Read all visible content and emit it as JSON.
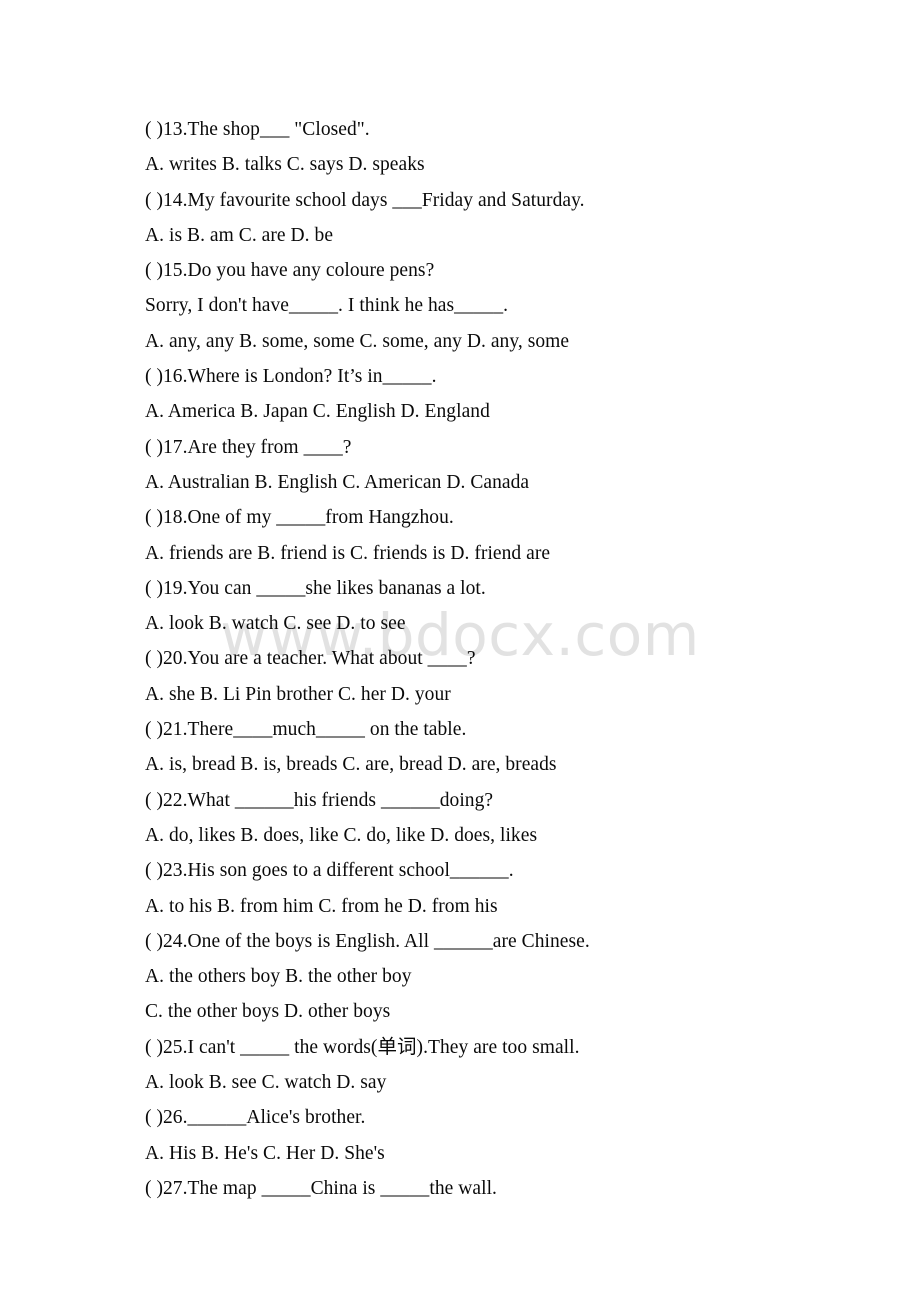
{
  "document": {
    "type": "english-multiple-choice-worksheet",
    "watermark": "www.bdocx.com",
    "text_color": "#0a0a0a",
    "watermark_color": "#e2e2e2",
    "background_color": "#ffffff",
    "lines": [
      {
        "id": "q13",
        "text": "( )13.The shop___ \"Closed\"."
      },
      {
        "id": "q13o",
        "text": "A. writes B. talks C. says D. speaks"
      },
      {
        "id": "q14",
        "text": "( )14.My favourite school days ___Friday and Saturday."
      },
      {
        "id": "q14o",
        "text": "A. is B. am C. are D. be"
      },
      {
        "id": "q15",
        "text": "( )15.Do you have any coloure pens?"
      },
      {
        "id": "q15b",
        "text": "Sorry, I don't have_____. I think he has_____."
      },
      {
        "id": "q15o",
        "text": "A. any, any B. some, some C. some, any D. any, some"
      },
      {
        "id": "q16",
        "text": "( )16.Where is London? It’s in_____."
      },
      {
        "id": "q16o",
        "text": "A. America B. Japan C. English D. England"
      },
      {
        "id": "q17",
        "text": "( )17.Are they from ____?"
      },
      {
        "id": "q17o",
        "text": "A. Australian B. English C. American D. Canada"
      },
      {
        "id": "q18",
        "text": "( )18.One of my _____from Hangzhou."
      },
      {
        "id": "q18o",
        "text": "A. friends are B. friend is C. friends is D. friend are"
      },
      {
        "id": "q19",
        "text": "( )19.You can _____she likes bananas a lot."
      },
      {
        "id": "q19o",
        "text": "A. look B. watch C. see D. to see"
      },
      {
        "id": "q20",
        "text": "( )20.You are a teacher. What about ____?"
      },
      {
        "id": "q20o",
        "text": "A. she B. Li Pin brother C. her D. your"
      },
      {
        "id": "q21",
        "text": "( )21.There____much_____ on the table."
      },
      {
        "id": "q21o",
        "text": "A. is, bread B. is, breads C. are, bread D. are, breads"
      },
      {
        "id": "q22",
        "text": "( )22.What ______his friends ______doing?"
      },
      {
        "id": "q22o",
        "text": "A. do, likes B. does, like C. do, like D. does, likes"
      },
      {
        "id": "q23",
        "text": "( )23.His son goes to a different school______."
      },
      {
        "id": "q23o",
        "text": "A. to his B. from him C. from he D. from his"
      },
      {
        "id": "q24",
        "text": "( )24.One of the boys is English. All ______are Chinese."
      },
      {
        "id": "q24oa",
        "text": "A. the others boy B. the other boy"
      },
      {
        "id": "q24ob",
        "text": "C. the other boys D. other boys"
      },
      {
        "id": "q25",
        "text": "( )25.I can't _____ the words(单词).They are too small."
      },
      {
        "id": "q25o",
        "text": "A. look B. see C. watch D. say"
      },
      {
        "id": "q26",
        "text": "( )26.______Alice's brother."
      },
      {
        "id": "q26o",
        "text": "A. His B. He's C. Her D. She's"
      },
      {
        "id": "q27",
        "text": "( )27.The map _____China is _____the wall."
      }
    ]
  }
}
